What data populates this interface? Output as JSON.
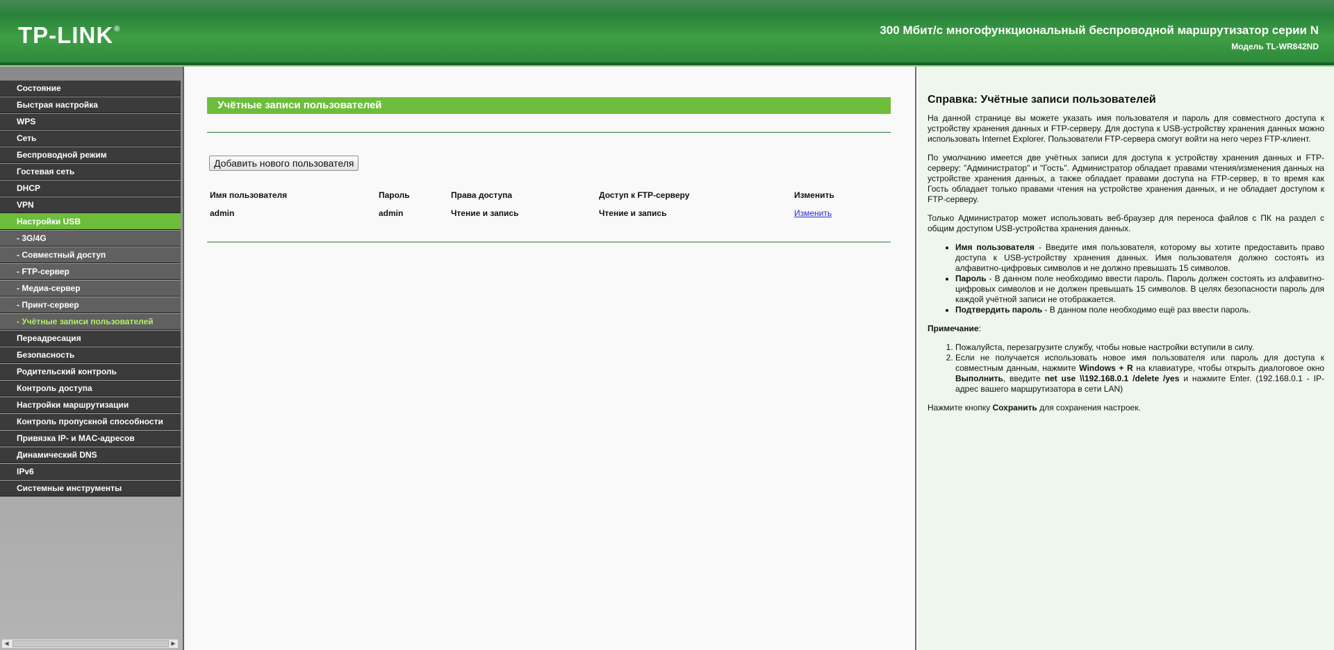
{
  "header": {
    "logo": "TP-LINK",
    "logo_reg": "®",
    "title": "300 Мбит/с многофункциональный беспроводной маршрутизатор серии N",
    "model": "Модель TL-WR842ND"
  },
  "colors": {
    "header_green": "#2e8b3e",
    "menu_bg": "#3b3b3b",
    "menu_active": "#6dbd3c",
    "submenu_bg": "#606060",
    "submenu_current_text": "#b6ee6a",
    "title_bar": "#6dbd3c",
    "help_bg": "#eff6ed",
    "link": "#2b2bd6"
  },
  "sidebar": {
    "items": [
      {
        "label": "Состояние"
      },
      {
        "label": "Быстрая настройка"
      },
      {
        "label": "WPS"
      },
      {
        "label": "Сеть"
      },
      {
        "label": "Беспроводной режим"
      },
      {
        "label": "Гостевая сеть"
      },
      {
        "label": "DHCP"
      },
      {
        "label": "VPN"
      },
      {
        "label": "Настройки USB"
      },
      {
        "label": "- 3G/4G"
      },
      {
        "label": "- Совместный доступ"
      },
      {
        "label": "- FTP-сервер"
      },
      {
        "label": "- Медиа-сервер"
      },
      {
        "label": "- Принт-сервер"
      },
      {
        "label": "- Учётные записи пользователей"
      },
      {
        "label": "Переадресация"
      },
      {
        "label": "Безопасность"
      },
      {
        "label": "Родительский контроль"
      },
      {
        "label": "Контроль доступа"
      },
      {
        "label": "Настройки маршрутизации"
      },
      {
        "label": "Контроль пропускной способности"
      },
      {
        "label": "Привязка IP- и MAC-адресов"
      },
      {
        "label": "Динамический DNS"
      },
      {
        "label": "IPv6"
      },
      {
        "label": "Системные инструменты"
      }
    ]
  },
  "main": {
    "title": "Учётные записи пользователей",
    "add_button": "Добавить нового пользователя",
    "table": {
      "headers": [
        "Имя пользователя",
        "Пароль",
        "Права доступа",
        "Доступ к FTP-серверу",
        "Изменить"
      ],
      "rows": [
        [
          "admin",
          "admin",
          "Чтение и запись",
          "Чтение и запись",
          "Изменить"
        ]
      ]
    }
  },
  "help": {
    "title": "Справка: Учётные записи пользователей",
    "p1": "На данной странице вы можете указать имя пользователя и пароль для совместного доступа к устройству хранения данных и FTP-серверу. Для доступа к USB-устройству хранения данных можно использовать Internet Explorer. Пользователи FTP-сервера смогут войти на него через FTP-клиент.",
    "p2": "По умолчанию имеется две учётных записи для доступа к устройству хранения данных и FTP-серверу: \"Администратор\" и \"Гость\". Администратор обладает правами чтения/изменения данных на устройстве хранения данных, а также обладает правами доступа на FTP-сервер, в то время как Гость обладает только правами чтения на устройстве хранения данных, и не обладает доступом к FTP-серверу.",
    "p3": "Только Администратор может использовать веб-браузер для переноса файлов с ПК на раздел с общим доступом USB-устройства хранения данных.",
    "bullets": [
      {
        "term": "Имя пользователя",
        "text": " - Введите имя пользователя, которому вы хотите предоставить право доступа к USB-устройству хранения данных. Имя пользователя должно состоять из алфавитно-цифровых символов и не должно превышать 15 символов."
      },
      {
        "term": "Пароль",
        "text": " - В данном поле необходимо ввести пароль. Пароль должен состоять из алфавитно-цифровых символов и не должен превышать 15 символов. В целях безопасности пароль для каждой учётной записи не отображается."
      },
      {
        "term": "Подтвердить пароль",
        "text": " - В данном поле необходимо ещё раз ввести пароль."
      }
    ],
    "note_label": "Примечание",
    "note_colon": ":",
    "note1": "Пожалуйста, перезагрузите службу, чтобы новые настройки вступили в силу.",
    "note2": {
      "t1": "Если не получается использовать новое имя пользователя или пароль для доступа к совместным данным, нажмите ",
      "b1": "Windows + R",
      "t2": " на клавиатуре, чтобы открыть диалоговое окно ",
      "b2": "Выполнить",
      "t3": ", введите ",
      "b3": "net use \\\\192.168.0.1 /delete /yes",
      "t4": " и нажмите Enter. (192.168.0.1 - IP-адрес вашего маршрутизатора в сети LAN)"
    },
    "final": {
      "t1": "Нажмите кнопку ",
      "b1": "Сохранить",
      "t2": " для сохранения настроек."
    }
  }
}
